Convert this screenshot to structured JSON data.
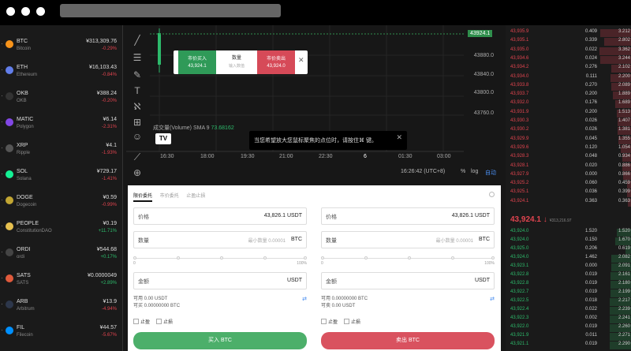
{
  "markets": [
    {
      "symbol": "BTC",
      "name": "Bitcoin",
      "price": "¥313,309.76",
      "change": "-0.29%",
      "dir": "neg",
      "color": "#f7931a"
    },
    {
      "symbol": "ETH",
      "name": "Ethereum",
      "price": "¥16,103.43",
      "change": "-0.84%",
      "dir": "neg",
      "color": "#627eea"
    },
    {
      "symbol": "OKB",
      "name": "OKB",
      "price": "¥388.24",
      "change": "-0.20%",
      "dir": "neg",
      "color": "#333333"
    },
    {
      "symbol": "MATIC",
      "name": "Polygon",
      "price": "¥6.14",
      "change": "-2.31%",
      "dir": "neg",
      "color": "#8247e5"
    },
    {
      "symbol": "XRP",
      "name": "Ripple",
      "price": "¥4.1",
      "change": "-1.93%",
      "dir": "neg",
      "color": "#555555"
    },
    {
      "symbol": "SOL",
      "name": "Solana",
      "price": "¥729.17",
      "change": "-1.41%",
      "dir": "neg",
      "color": "#14f195"
    },
    {
      "symbol": "DOGE",
      "name": "Dogecoin",
      "price": "¥0.59",
      "change": "-0.99%",
      "dir": "neg",
      "color": "#c2a633"
    },
    {
      "symbol": "PEOPLE",
      "name": "ConstitutionDAO",
      "price": "¥0.19",
      "change": "+11.71%",
      "dir": "pos",
      "color": "#e6c04f"
    },
    {
      "symbol": "ORDI",
      "name": "ordi",
      "price": "¥544.68",
      "change": "+0.17%",
      "dir": "pos",
      "color": "#444444"
    },
    {
      "symbol": "SATS",
      "name": "SATS",
      "price": "¥0.0000049",
      "change": "+2.89%",
      "dir": "pos",
      "color": "#e05a3c"
    },
    {
      "symbol": "ARB",
      "name": "Arbitrum",
      "price": "¥13.9",
      "change": "-4.94%",
      "dir": "neg",
      "color": "#2d374b"
    },
    {
      "symbol": "FIL",
      "name": "Filecoin",
      "price": "¥44.57",
      "change": "-5.67%",
      "dir": "neg",
      "color": "#0090ff"
    }
  ],
  "chart": {
    "price_tag": "43924.1",
    "y_ticks": [
      "43880.0",
      "43840.0",
      "43800.0",
      "43760.0"
    ],
    "x_ticks": [
      "16:30",
      "18:00",
      "19:30",
      "21:00",
      "22:30",
      "6",
      "01:30",
      "03:00"
    ],
    "volume_label": "成交量(Volume) SMA 9",
    "volume_value": "73.68162",
    "time": "16:26:42 (UTC+8)",
    "pct": "%",
    "log": "log",
    "auto": "自动"
  },
  "quick_order": {
    "buy_title": "市价买入",
    "buy_price": "43,924.1",
    "qty_title": "数量",
    "qty_ph": "输入数值",
    "sell_title": "市价卖出",
    "sell_price": "43,924.0"
  },
  "toast": "当您希望放大您鼠标聚焦的点位时，请按住⌘ 键。",
  "panel": {
    "tabs": [
      "限价委托",
      "市价委托",
      "止盈止损"
    ],
    "price_label": "价格",
    "price_value": "43,826.1",
    "price_unit": "USDT",
    "qty_label": "数量",
    "qty_ph": "最小数量 0.00001",
    "qty_unit": "BTC",
    "amt_label": "金额",
    "amt_unit": "USDT",
    "slider_min": "0",
    "slider_max": "100%",
    "buy_avail": "可用 0.00 USDT",
    "buy_can": "可买 0.00000000 BTC",
    "sell_avail": "可用 0.00000000 BTC",
    "sell_can": "可卖 0.00 USDT",
    "tp": "止盈",
    "sl": "止损",
    "buy_btn": "买入 BTC",
    "sell_btn": "卖出 BTC"
  },
  "asks": [
    [
      "43,935.9",
      "0.409",
      "3.212"
    ],
    [
      "43,935.1",
      "0.339",
      "2.802"
    ],
    [
      "43,935.0",
      "0.022",
      "3.362"
    ],
    [
      "43,934.6",
      "0.024",
      "3.244"
    ],
    [
      "43,934.2",
      "0.276",
      "2.102"
    ],
    [
      "43,934.0",
      "0.111",
      "2.200"
    ],
    [
      "43,933.8",
      "0.270",
      "2.089"
    ],
    [
      "43,933.7",
      "0.200",
      "1.889"
    ],
    [
      "43,932.0",
      "0.176",
      "1.689"
    ],
    [
      "43,931.9",
      "0.200",
      "1.513"
    ],
    [
      "43,930.3",
      "0.026",
      "1.407"
    ],
    [
      "43,930.2",
      "0.026",
      "1.381"
    ],
    [
      "43,929.9",
      "0.045",
      "1.355"
    ],
    [
      "43,929.6",
      "0.120",
      "1.054"
    ],
    [
      "43,928.3",
      "0.048",
      "0.934"
    ],
    [
      "43,928.1",
      "0.020",
      "0.886"
    ],
    [
      "43,927.9",
      "0.000",
      "0.866"
    ],
    [
      "43,925.2",
      "0.060",
      "0.459"
    ],
    [
      "43,925.1",
      "0.036",
      "0.399"
    ],
    [
      "43,924.1",
      "0.363",
      "0.363"
    ]
  ],
  "mid_price": "43,924.1",
  "mid_arrow": "↓",
  "mid_sub": "¥313,216.97",
  "bids": [
    [
      "43,924.0",
      "1.520",
      "1.520"
    ],
    [
      "43,924.0",
      "0.150",
      "1.670"
    ],
    [
      "43,925.0",
      "0.206",
      "0.619"
    ],
    [
      "43,924.0",
      "1.462",
      "2.082"
    ],
    [
      "43,923.1",
      "0.000",
      "2.091"
    ],
    [
      "43,922.8",
      "0.019",
      "2.161"
    ],
    [
      "43,922.8",
      "0.019",
      "2.180"
    ],
    [
      "43,922.7",
      "0.019",
      "2.199"
    ],
    [
      "43,922.5",
      "0.018",
      "2.217"
    ],
    [
      "43,922.4",
      "0.022",
      "2.239"
    ],
    [
      "43,922.3",
      "0.002",
      "2.241"
    ],
    [
      "43,922.0",
      "0.019",
      "2.260"
    ],
    [
      "43,921.9",
      "0.011",
      "2.271"
    ],
    [
      "43,921.1",
      "0.019",
      "2.290"
    ]
  ]
}
